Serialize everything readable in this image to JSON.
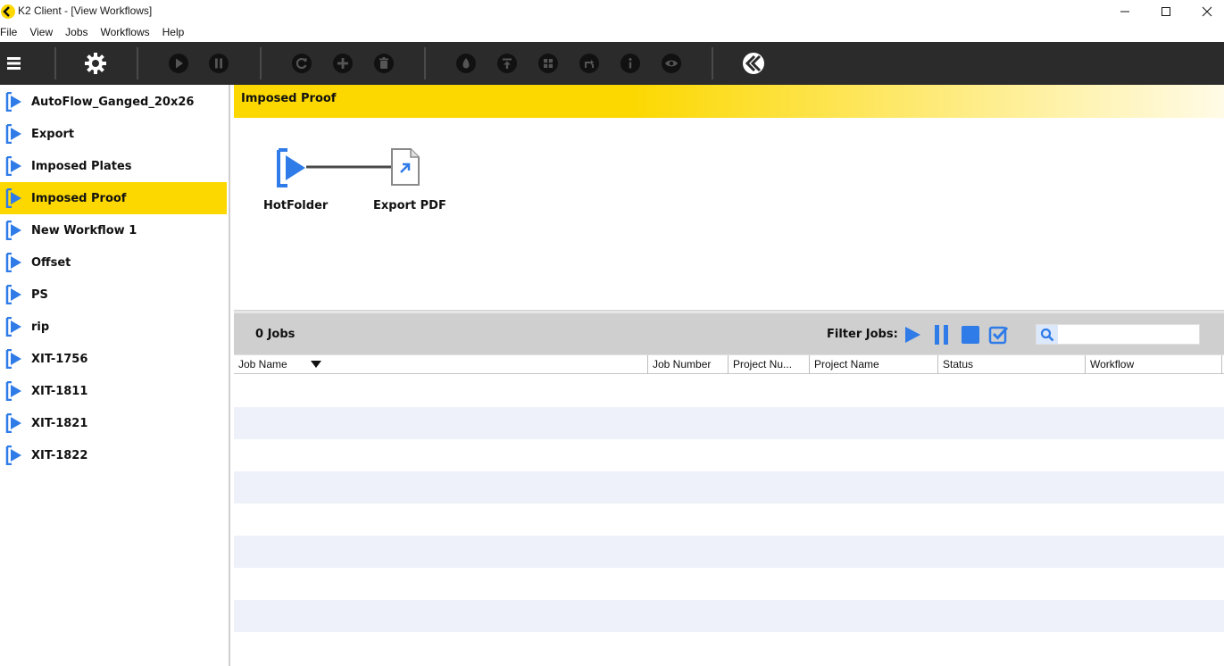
{
  "window": {
    "title": "K2 Client - [View Workflows]"
  },
  "menu": [
    "File",
    "View",
    "Jobs",
    "Workflows",
    "Help"
  ],
  "toolbar": {
    "buttons": [
      "menu-icon",
      "settings-icon",
      "play-icon",
      "pause-icon",
      "refresh-icon",
      "add-icon",
      "delete-icon",
      "ink-icon",
      "upload-icon",
      "grid-icon",
      "reroute-icon",
      "info-icon",
      "preview-icon",
      "k2-logo"
    ]
  },
  "sidebar": {
    "items": [
      {
        "label": "AutoFlow_Ganged_20x26",
        "selected": false
      },
      {
        "label": "Export",
        "selected": false
      },
      {
        "label": "Imposed Plates",
        "selected": false
      },
      {
        "label": "Imposed Proof",
        "selected": true
      },
      {
        "label": "New Workflow 1",
        "selected": false
      },
      {
        "label": "Offset",
        "selected": false
      },
      {
        "label": "PS",
        "selected": false
      },
      {
        "label": "rip",
        "selected": false
      },
      {
        "label": "XIT-1756",
        "selected": false
      },
      {
        "label": "XIT-1811",
        "selected": false
      },
      {
        "label": "XIT-1821",
        "selected": false
      },
      {
        "label": "XIT-1822",
        "selected": false
      }
    ]
  },
  "diagram": {
    "title": "Imposed Proof",
    "nodes": [
      {
        "label": "HotFolder",
        "icon": "hotfolder-icon"
      },
      {
        "label": "Export PDF",
        "icon": "export-pdf-icon"
      }
    ]
  },
  "jobs": {
    "count_label": "0 Jobs",
    "filter_label": "Filter Jobs:",
    "search_placeholder": "",
    "columns": [
      "Job Name",
      "Job Number",
      "Project Nu...",
      "Project Name",
      "Status",
      "Workflow"
    ],
    "sort_column": "Job Name",
    "rows": []
  },
  "colors": {
    "accent_yellow": "#fcd800",
    "toolbar_bg": "#2b2b2b",
    "icon_blue": "#2f7be8"
  }
}
